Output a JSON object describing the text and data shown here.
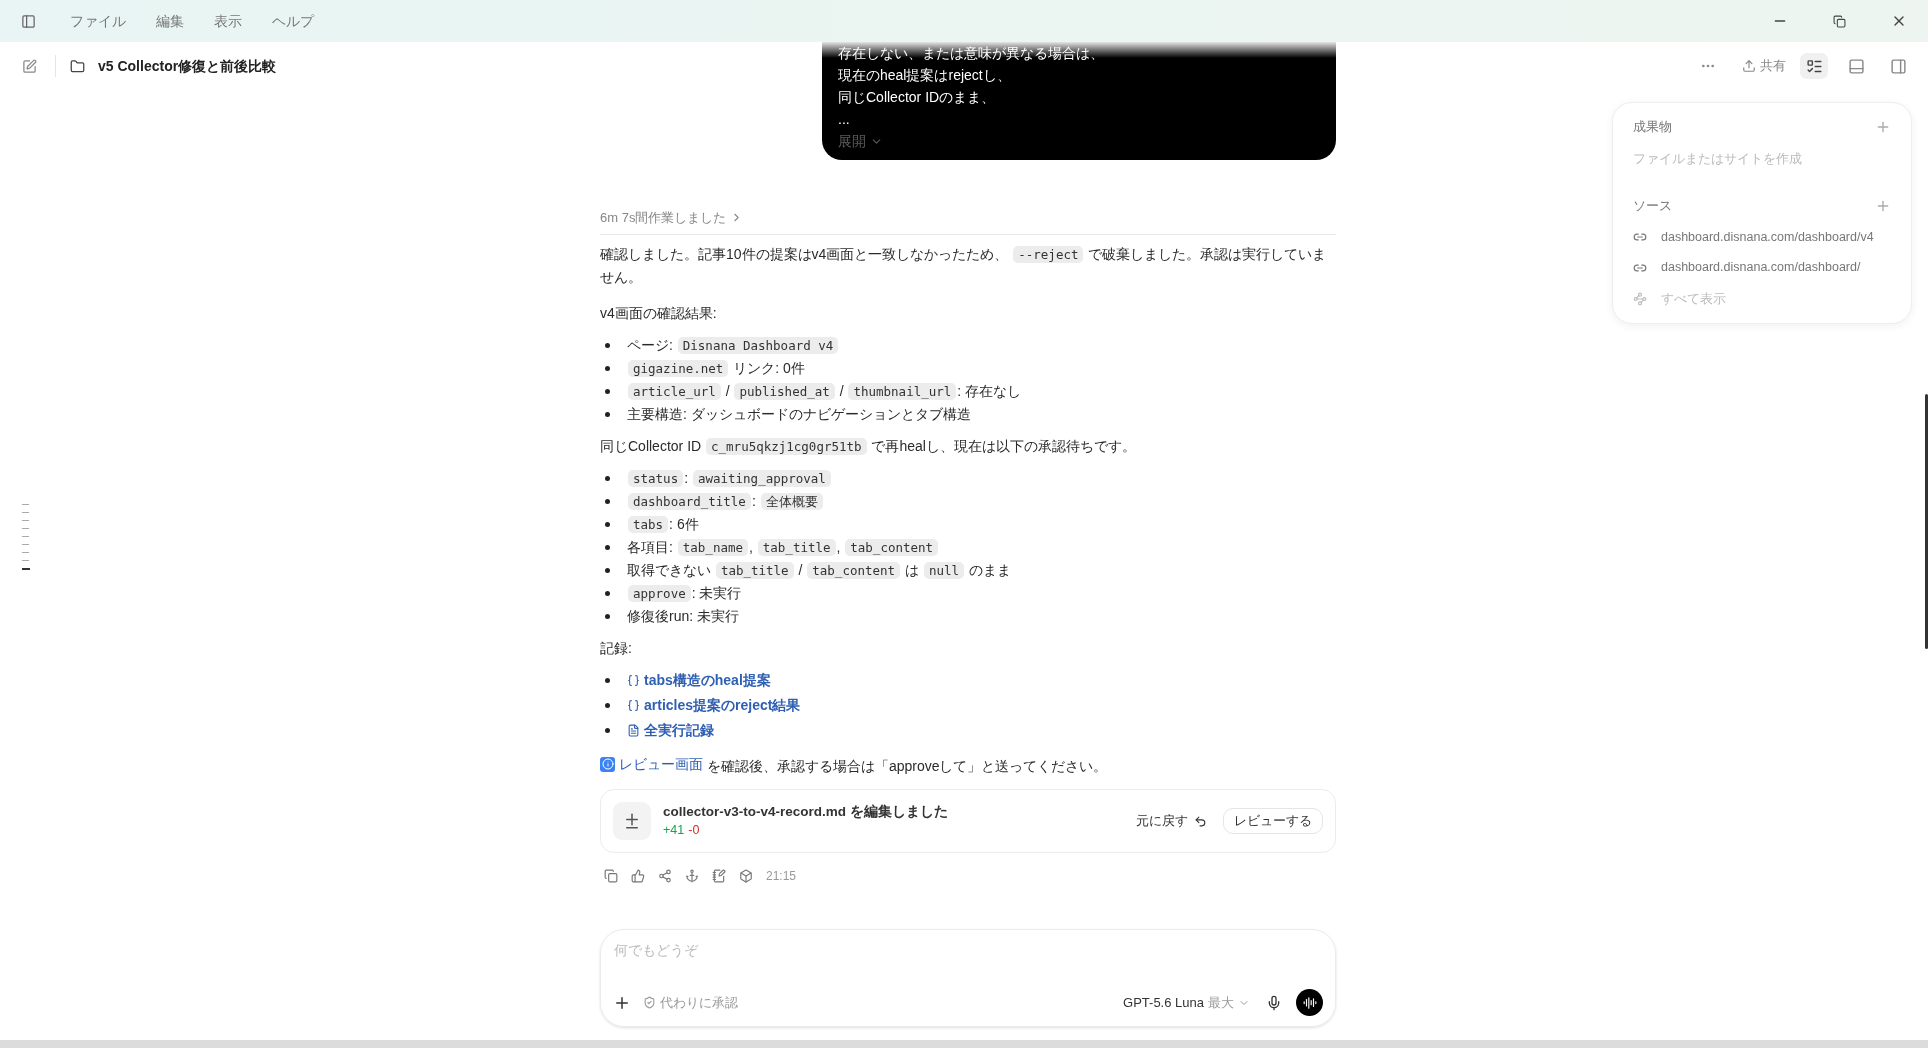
{
  "window": {
    "menu": [
      "ファイル",
      "編集",
      "表示",
      "ヘルプ"
    ]
  },
  "header": {
    "title": "v5 Collector修復と前後比較",
    "share": "共有",
    "panels": [
      {
        "kind": "list",
        "selected": true
      },
      {
        "kind": "bottom",
        "selected": false
      },
      {
        "kind": "side",
        "selected": false
      }
    ]
  },
  "prompt_card": {
    "lines": [
      "存在しない、または意味が異なる場合は、",
      "現在のheal提案はrejectし、",
      "同じCollector IDのまま、",
      "..."
    ],
    "expand": "展開"
  },
  "work_summary": "6m 7s間作業しました",
  "message": [
    {
      "kind": "paragraph",
      "segments": [
        {
          "kind": "text",
          "text": "確認しました。記事10件の提案はv4画面と一致しなかったため、 "
        },
        {
          "kind": "code",
          "text": "--reject"
        },
        {
          "kind": "text",
          "text": " で破棄しました。承認は実行していません。"
        }
      ]
    },
    {
      "kind": "paragraph",
      "segments": [
        {
          "kind": "text",
          "text": "v4画面の確認結果:"
        }
      ]
    },
    {
      "kind": "list",
      "items": [
        [
          {
            "kind": "text",
            "text": "ページ: "
          },
          {
            "kind": "code",
            "text": "Disnana Dashboard v4"
          }
        ],
        [
          {
            "kind": "code",
            "text": "gigazine.net"
          },
          {
            "kind": "text",
            "text": " リンク: 0件"
          }
        ],
        [
          {
            "kind": "code",
            "text": "article_url"
          },
          {
            "kind": "text",
            "text": " / "
          },
          {
            "kind": "code",
            "text": "published_at"
          },
          {
            "kind": "text",
            "text": " / "
          },
          {
            "kind": "code",
            "text": "thumbnail_url"
          },
          {
            "kind": "text",
            "text": ": 存在なし"
          }
        ],
        [
          {
            "kind": "text",
            "text": "主要構造: ダッシュボードのナビゲーションとタブ構造"
          }
        ]
      ]
    },
    {
      "kind": "paragraph",
      "segments": [
        {
          "kind": "text",
          "text": "同じCollector ID "
        },
        {
          "kind": "code",
          "text": "c_mru5qkzj1cg0gr51tb"
        },
        {
          "kind": "text",
          "text": " で再healし、現在は以下の承認待ちです。"
        }
      ]
    },
    {
      "kind": "list",
      "items": [
        [
          {
            "kind": "code",
            "text": "status"
          },
          {
            "kind": "text",
            "text": ": "
          },
          {
            "kind": "code",
            "text": "awaiting_approval"
          }
        ],
        [
          {
            "kind": "code",
            "text": "dashboard_title"
          },
          {
            "kind": "text",
            "text": ": "
          },
          {
            "kind": "code",
            "text": "全体概要"
          }
        ],
        [
          {
            "kind": "code",
            "text": "tabs"
          },
          {
            "kind": "text",
            "text": ": 6件"
          }
        ],
        [
          {
            "kind": "text",
            "text": "各項目: "
          },
          {
            "kind": "code",
            "text": "tab_name"
          },
          {
            "kind": "text",
            "text": ", "
          },
          {
            "kind": "code",
            "text": "tab_title"
          },
          {
            "kind": "text",
            "text": ", "
          },
          {
            "kind": "code",
            "text": "tab_content"
          }
        ],
        [
          {
            "kind": "text",
            "text": "取得できない "
          },
          {
            "kind": "code",
            "text": "tab_title"
          },
          {
            "kind": "text",
            "text": " / "
          },
          {
            "kind": "code",
            "text": "tab_content"
          },
          {
            "kind": "text",
            "text": " は "
          },
          {
            "kind": "code",
            "text": "null"
          },
          {
            "kind": "text",
            "text": " のまま"
          }
        ],
        [
          {
            "kind": "code",
            "text": "approve"
          },
          {
            "kind": "text",
            "text": ": 未実行"
          }
        ],
        [
          {
            "kind": "text",
            "text": "修復後run: 未実行"
          }
        ]
      ]
    },
    {
      "kind": "paragraph",
      "segments": [
        {
          "kind": "text",
          "text": "記録:"
        }
      ]
    },
    {
      "kind": "list",
      "items": [
        [
          {
            "kind": "json_link",
            "text": "tabs構造のheal提案"
          }
        ],
        [
          {
            "kind": "json_link",
            "text": "articles提案のreject結果"
          }
        ],
        [
          {
            "kind": "doc_link",
            "text": "全実行記録"
          }
        ]
      ]
    },
    {
      "kind": "paragraph",
      "segments": [
        {
          "kind": "info_link",
          "text": "レビュー画面"
        },
        {
          "kind": "text",
          "text": " を確認後、承認する場合は「approveして」と送ってください。"
        }
      ]
    }
  ],
  "file_card": {
    "title": "collector-v3-to-v4-record.md を編集しました",
    "added": "+41",
    "removed": "-0",
    "undo": "元に戻す",
    "review": "レビューする"
  },
  "time": "21:15",
  "composer": {
    "placeholder": "何でもどうぞ",
    "approval": "代わりに承認",
    "model": "GPT-5.6 Luna",
    "effort": "最大"
  },
  "panel": {
    "artifacts": {
      "title": "成果物",
      "empty": "ファイルまたはサイトを作成"
    },
    "sources": {
      "title": "ソース",
      "items": [
        "dashboard.disnana.com/dashboard/v4",
        "dashboard.disnana.com/dashboard/"
      ],
      "show_all": "すべて表示"
    }
  }
}
